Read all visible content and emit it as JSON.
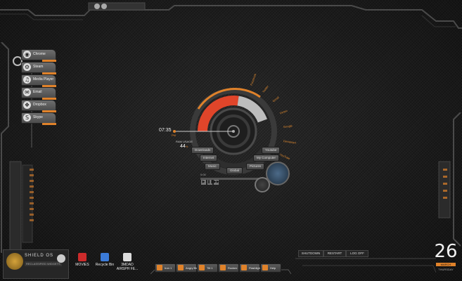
{
  "launcher": {
    "items": [
      {
        "label": "Chrome",
        "icon": "chrome-icon",
        "glyph": "◉"
      },
      {
        "label": "Steam",
        "icon": "steam-icon",
        "glyph": "⚙"
      },
      {
        "label": "Media Player",
        "icon": "music-icon",
        "glyph": "♫"
      },
      {
        "label": "Email",
        "icon": "email-icon",
        "glyph": "✉"
      },
      {
        "label": "Dropbox",
        "icon": "dropbox-icon",
        "glyph": "❖"
      },
      {
        "label": "Skype",
        "icon": "skype-icon",
        "glyph": "S"
      }
    ]
  },
  "hud": {
    "time": "07:35",
    "ampm": "PM",
    "ram_label": "RAM USAGE",
    "ram_value": "44",
    "ram_unit": "%",
    "ram_fraction": 0.44,
    "quick_links": [
      "Downloads",
      "Internet",
      "Music",
      "Youtube",
      "My Computer",
      "Pictures",
      "Global"
    ],
    "arc_labels": [
      "Facebook",
      "Twitter",
      "Gmail",
      "Vimeo",
      "Google",
      "Deviantart",
      "YouTube",
      "Wikipedia"
    ],
    "media_time": "0:00"
  },
  "shield": {
    "title": "SHIELD OS",
    "subtitle": "RECLASSIFIED WIDGETS"
  },
  "desktop_icons": [
    {
      "label": "MOVIES",
      "color": "#cc2b2b"
    },
    {
      "label": "Recycle Bin",
      "color": "#3b7bd8"
    },
    {
      "label": "3MDAD AIRSPH FE...",
      "color": "#dcdcdc"
    }
  ],
  "taskbar": {
    "items": [
      "Iron 1",
      "Angry Birds",
      "Tilt 1",
      "Rockex",
      "Flashlight",
      "Help"
    ]
  },
  "system": {
    "shutdown": "SHUTDOWN",
    "restart": "RESTART",
    "logoff": "LOG OFF"
  },
  "date": {
    "day": "26",
    "month": "MARCH",
    "weekday": "THURSDAY"
  },
  "colors": {
    "accent": "#e0822a",
    "hud_red": "#e0452a",
    "bg": "#1b1b1b"
  }
}
